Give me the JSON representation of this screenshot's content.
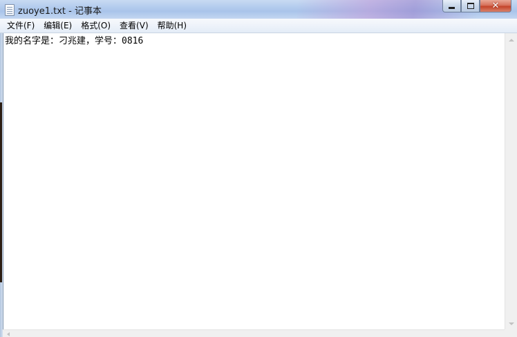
{
  "window": {
    "title": "zuoye1.txt - 记事本",
    "icon": "notepad-icon"
  },
  "caption_buttons": {
    "minimize": "minimize-icon",
    "maximize": "maximize-icon",
    "close": "close-icon",
    "close_glyph": "✕"
  },
  "menu": {
    "items": [
      {
        "label": "文件(F)"
      },
      {
        "label": "编辑(E)"
      },
      {
        "label": "格式(O)"
      },
      {
        "label": "查看(V)"
      },
      {
        "label": "帮助(H)"
      }
    ]
  },
  "editor": {
    "content": "我的名字是：刁兆建，学号：0816"
  },
  "colors": {
    "close_button": "#c4442a",
    "titlebar": "#b5cdee",
    "menubar": "#e4ecf7"
  }
}
